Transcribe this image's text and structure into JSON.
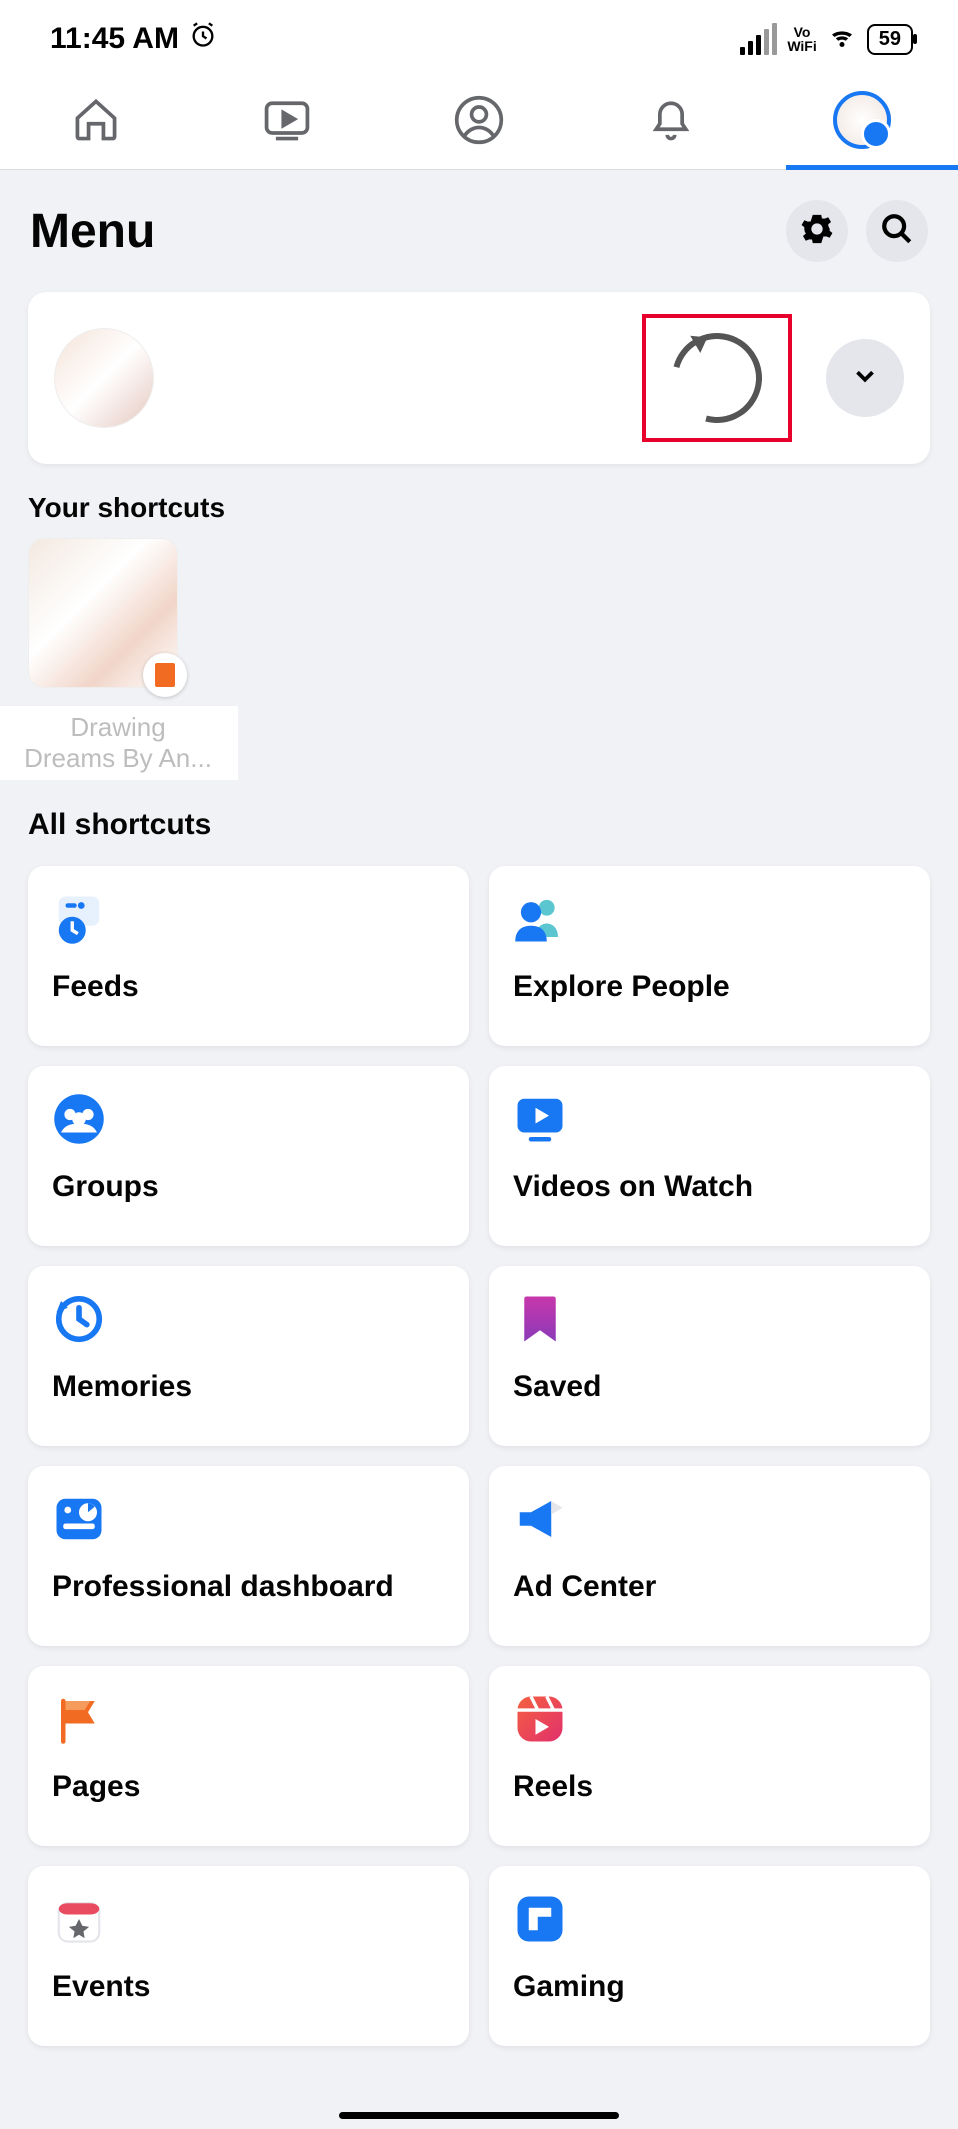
{
  "status": {
    "time": "11:45 AM",
    "battery": "59",
    "vo": "Vo",
    "wifi": "WiFi"
  },
  "header": {
    "title": "Menu"
  },
  "shortcuts": {
    "section_label": "Your shortcuts",
    "item_line1": "Drawing",
    "item_line2": "Dreams By An..."
  },
  "all_shortcuts_label": "All shortcuts",
  "tiles": {
    "feeds": "Feeds",
    "explore": "Explore People",
    "groups": "Groups",
    "videos": "Videos on Watch",
    "memories": "Memories",
    "saved": "Saved",
    "prof": "Professional dashboard",
    "ad": "Ad Center",
    "pages": "Pages",
    "reels": "Reels",
    "events": "Events",
    "gaming": "Gaming"
  }
}
